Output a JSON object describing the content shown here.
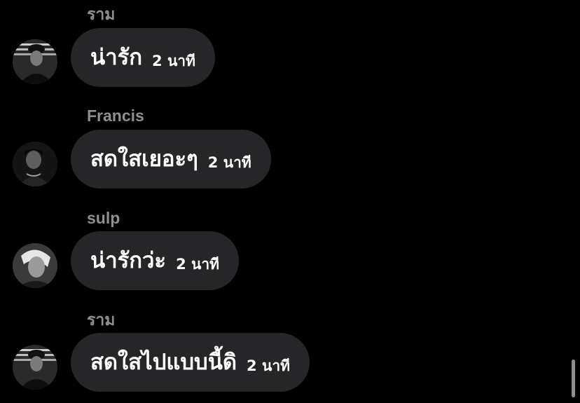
{
  "messages": [
    {
      "sender": "ราม",
      "text": "น่ารัก",
      "time": "2 นาที",
      "avatar_icon": "avatar-ram-icon"
    },
    {
      "sender": "Francis",
      "text": "สดใสเยอะๆ",
      "time": "2 นาที",
      "avatar_icon": "avatar-francis-icon"
    },
    {
      "sender": "sulp",
      "text": "น่ารักว่ะ",
      "time": "2 นาที",
      "avatar_icon": "avatar-sulp-icon"
    },
    {
      "sender": "ราม",
      "text": "สดใสไปแบบนี้ดิ",
      "time": "2 นาที",
      "avatar_icon": "avatar-ram-icon"
    }
  ],
  "colors": {
    "background": "#000000",
    "bubble": "#262628",
    "sender_name": "#8e8e93",
    "text": "#ffffff"
  }
}
